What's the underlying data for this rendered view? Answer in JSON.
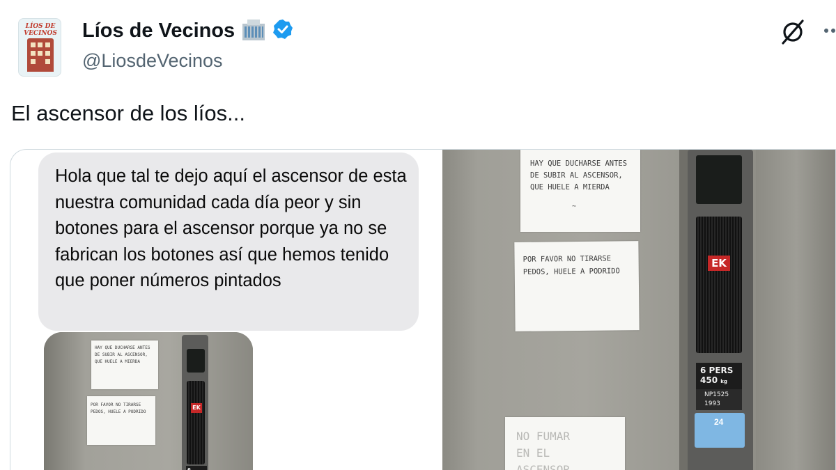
{
  "account": {
    "display_name": "Líos de Vecinos",
    "building_emoji_icon": "office-building-icon",
    "verified_icon": "verified-badge-icon",
    "handle": "@LiosdeVecinos",
    "avatar_text": "LÍOS DE VECINOS"
  },
  "tweet": {
    "text": "El ascensor de los líos..."
  },
  "chat_message": {
    "text": "Hola que tal te dejo aquí el ascensor de esta nuestra comunidad cada día peor y sin botones para el ascensor porque ya no se fabrican los botones así que hemos tenido que poner números pintados"
  },
  "photo": {
    "note_1": [
      "HAY QUE DUCHARSE ANTES",
      "DE SUBIR AL ASCENSOR,",
      "QUE HUELE A MIERDA"
    ],
    "note_2": [
      "POR FAVOR NO TIRARSE",
      "PEDOS, HUELE A PODRIDO"
    ],
    "note_3": [
      "NO FUMAR",
      "EN EL",
      "ASCENSOR"
    ],
    "brand": "EK",
    "capacity_persons": "6 PERS",
    "capacity_kg": "450",
    "kg_unit": "kg",
    "serial": "NP1525",
    "year": "1993",
    "floor_number": "24"
  },
  "colors": {
    "verified": "#1d9bf0",
    "secondary_text": "#536471",
    "bubble": "#e9e9eb"
  }
}
